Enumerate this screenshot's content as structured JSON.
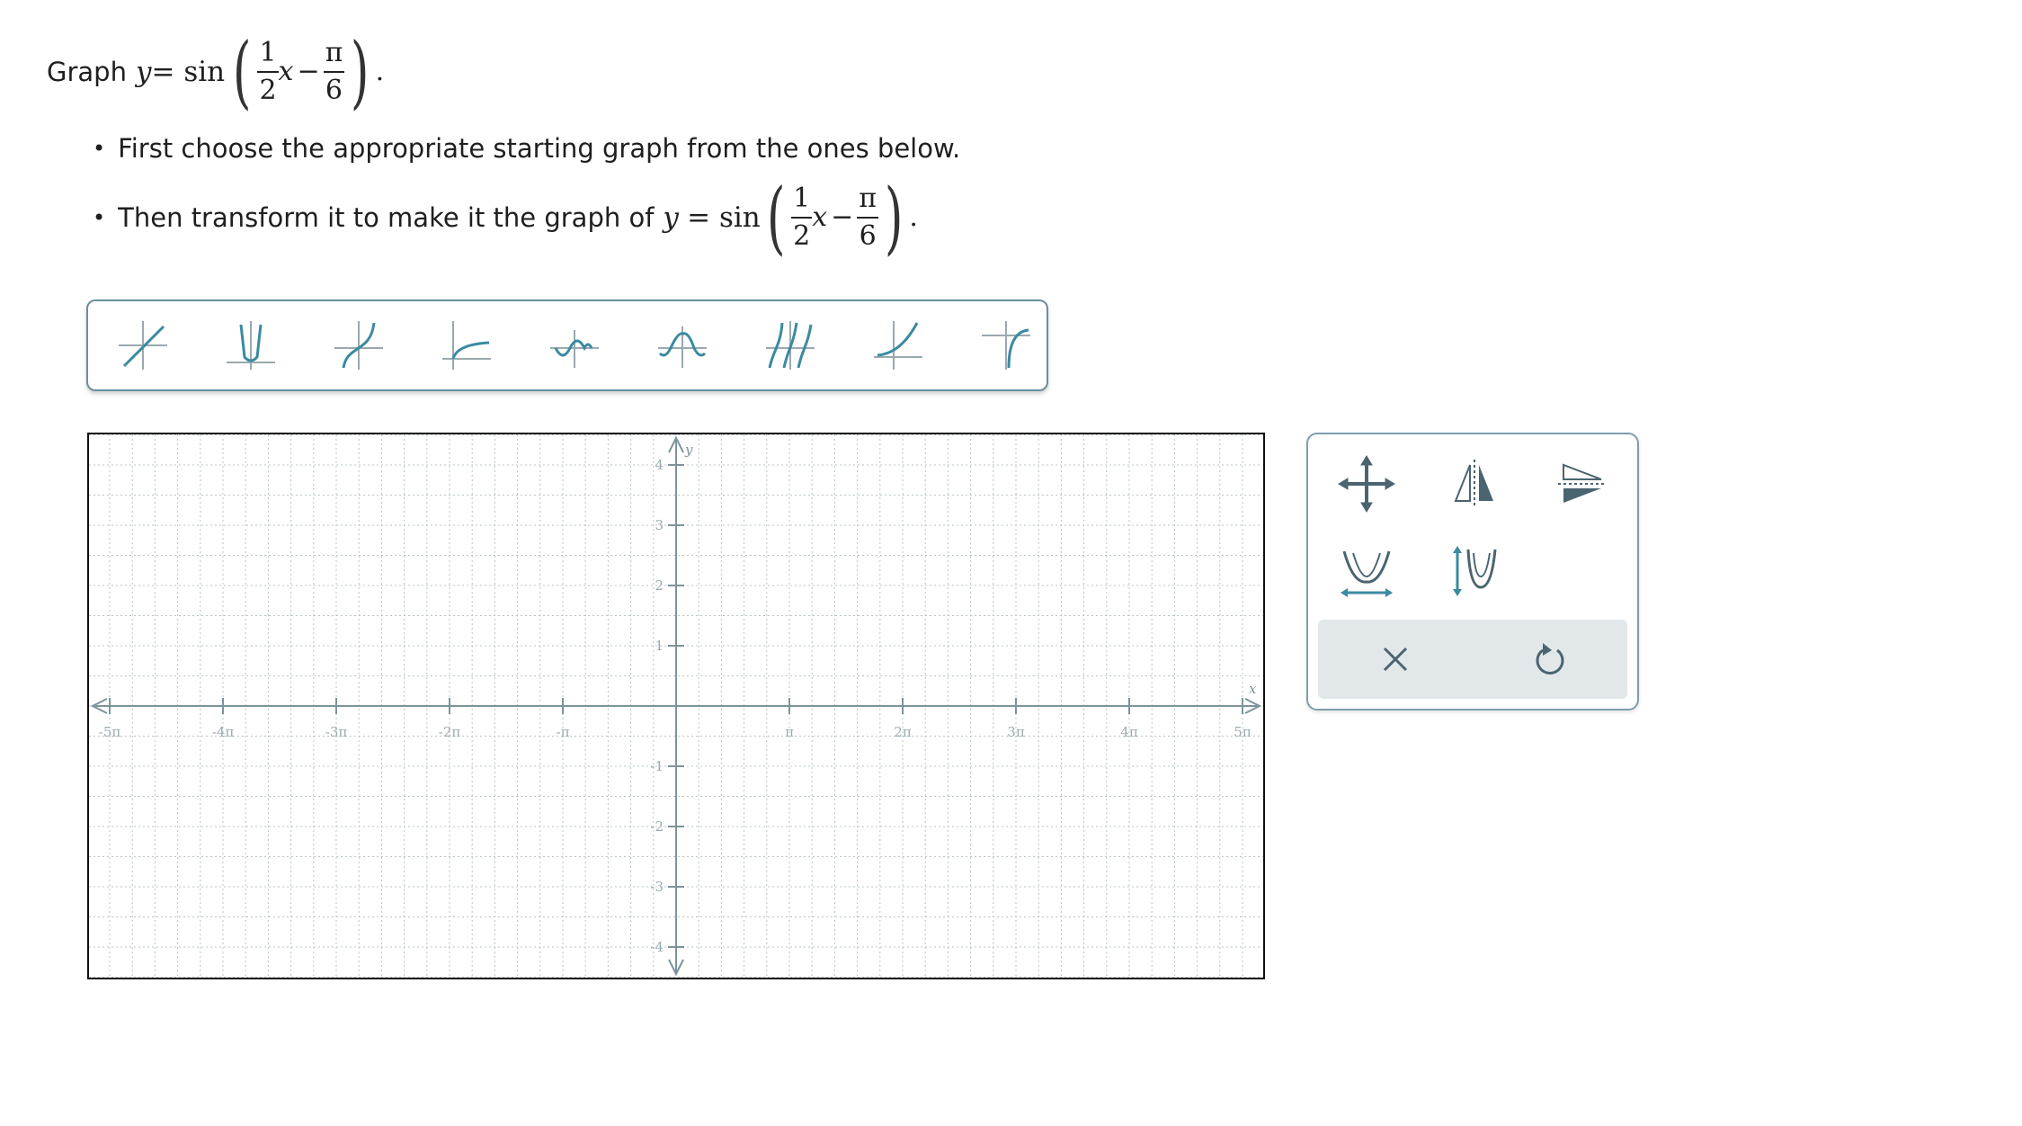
{
  "prompt": {
    "lead": "Graph",
    "var": "y",
    "eq": "= sin",
    "num1": "1",
    "den1": "2",
    "x": "x",
    "minus": "−",
    "num2": "π",
    "den2": "6",
    "end": "."
  },
  "instructions": {
    "bullet1": "First choose the appropriate starting graph from the ones below.",
    "bullet2_text": "Then transform it to make it the graph of"
  },
  "toolbar": {
    "icons": [
      "linear-graph-icon",
      "absolute-value-graph-icon",
      "cubic-graph-icon",
      "square-root-graph-icon",
      "sine-graph-icon",
      "cosine-graph-icon",
      "tangent-graph-icon",
      "exponential-graph-icon",
      "reciprocal-graph-icon"
    ]
  },
  "graph": {
    "x_axis_label": "x",
    "y_axis_label": "y",
    "x_tick_labels": [
      "-5π",
      "-4π",
      "-3π",
      "-2π",
      "-π",
      "π",
      "2π",
      "3π",
      "4π",
      "5π"
    ],
    "y_tick_labels": [
      "4",
      "3",
      "2",
      "1",
      "-1",
      "-2",
      "-3",
      "-4"
    ],
    "x_range": [
      "-5π",
      "5π"
    ],
    "y_range": [
      -4.5,
      4.5
    ],
    "grid": true
  },
  "tools": {
    "icons": [
      "move-icon",
      "reflect-horizontal-icon",
      "reflect-vertical-icon",
      "horizontal-stretch-icon",
      "vertical-stretch-icon"
    ],
    "clear": "clear-icon",
    "undo": "undo-icon"
  },
  "colors": {
    "accent": "#3a8aa0",
    "tool_dark": "#4a6470",
    "frame": "#6a8fa0",
    "grid": "#b8c4c8",
    "axis": "#7d949c"
  }
}
